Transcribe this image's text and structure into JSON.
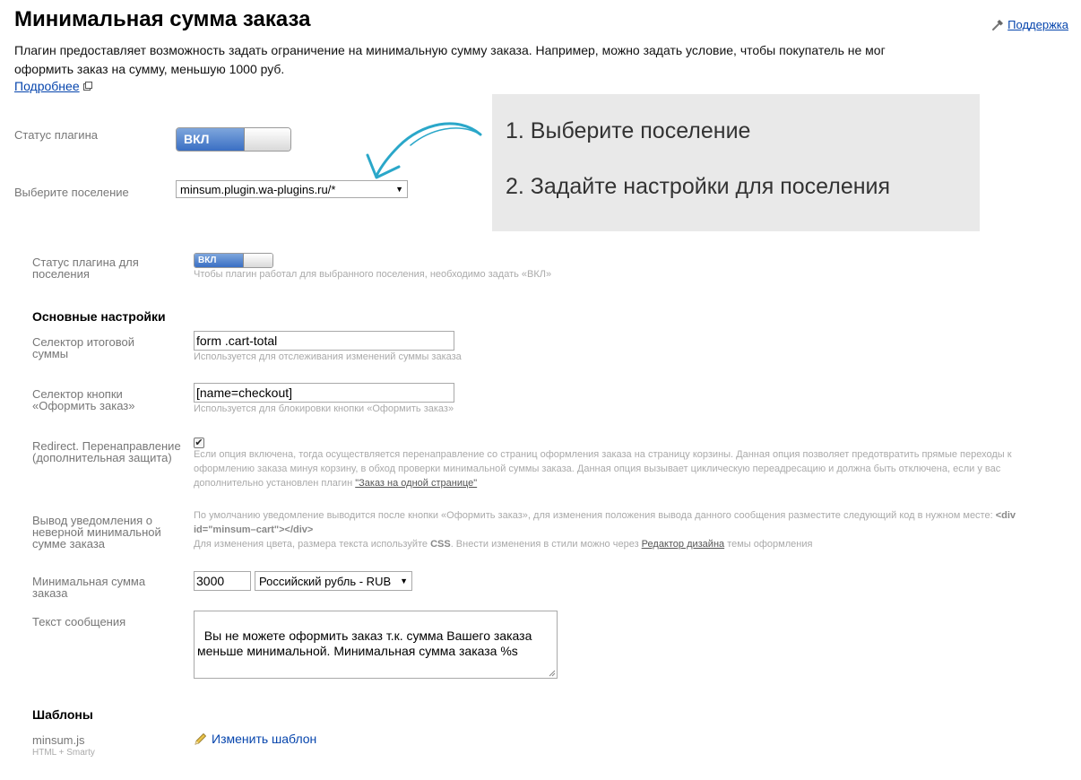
{
  "header": {
    "title": "Минимальная сумма заказа",
    "support_label": "Поддержка",
    "intro": "Плагин предоставляет возможность задать ограничение на минимальную сумму заказа. Например, можно задать условие, чтобы покупатель не мог оформить заказ на сумму, меньшую 1000 руб.",
    "more_label": "Подробнее"
  },
  "global": {
    "status_label": "Статус плагина",
    "status_toggle": "ВКЛ",
    "settlement_label": "Выберите поселение",
    "settlement_value": "minsum.plugin.wa-plugins.ru/*"
  },
  "callout": {
    "step1": "1. Выберите поселение",
    "step2": "2. Задайте настройки для поселения"
  },
  "settlement": {
    "status_label": "Статус плагина для поселения",
    "status_toggle": "ВКЛ",
    "status_hint": "Чтобы плагин работал для выбранного поселения, необходимо задать «ВКЛ»"
  },
  "basic": {
    "heading": "Основные настройки",
    "total_selector_label": "Селектор итоговой суммы",
    "total_selector_value": "form .cart-total",
    "total_selector_hint": "Используется для отслеживания изменений суммы заказа",
    "button_selector_label": "Селектор кнопки «Оформить заказ»",
    "button_selector_value": "[name=checkout]",
    "button_selector_hint": "Используется для блокировки кнопки «Оформить заказ»",
    "redirect_label": "Redirect. Перенаправление (дополнительная защита)",
    "redirect_checked": true,
    "redirect_hint": "Если опция включена, тогда осуществляется перенаправление со страниц оформления заказа на страницу корзины. Данная опция позволяет предотвратить прямые переходы к оформлению заказа минуя корзину, в обход проверки минимальной суммы заказа. Данная опция вызывает циклическую переадресацию и должна быть отключена, если у вас дополнительно установлен плагин ",
    "redirect_hint_link": "\"Заказ на одной странице\"",
    "notice_label": "Вывод уведомления о неверной минимальной сумме заказа",
    "notice_hint_1": "По умолчанию уведомление выводится после кнопки «Оформить заказ», для изменения положения вывода данного сообщения разместите следующий код в нужном месте: ",
    "notice_hint_code": "<div id=\"minsum–cart\"></div>",
    "notice_hint_2a": "Для изменения цвета, размера текста используйте ",
    "notice_hint_css": "CSS",
    "notice_hint_2b": ". Внести изменения в стили можно через ",
    "notice_hint_link": "Редактор дизайна",
    "notice_hint_2c": " темы оформления",
    "min_sum_label": "Минимальная сумма заказа",
    "min_sum_value": "3000",
    "currency_value": "Российский рубль - RUB",
    "message_label": "Текст сообщения",
    "message_value": "Вы не можете оформить заказ т.к. сумма Вашего заказа меньше минимальной. Минимальная сумма заказа %s"
  },
  "templates": {
    "heading": "Шаблоны",
    "file_name": "minsum.js",
    "file_type": "HTML + Smarty",
    "edit_label": "Изменить шаблон"
  },
  "colors": {
    "link": "#0645ad",
    "toggle_on": "#3a6fc4",
    "callout_bg": "#e9e9e9",
    "arrow": "#2aa7c9"
  }
}
